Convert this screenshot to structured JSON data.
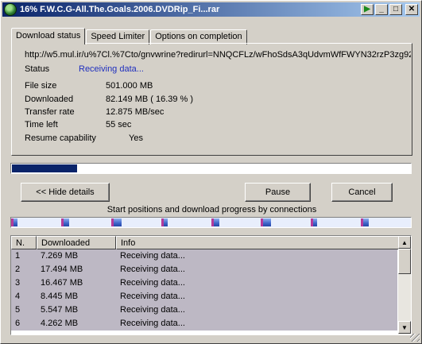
{
  "window": {
    "title": "16% F.W.C.G-All.The.Goals.2006.DVDRip_Fi...rar"
  },
  "tabs": [
    "Download status",
    "Speed Limiter",
    "Options on completion"
  ],
  "details": {
    "url": "http://w5.mul.ir/u%7Cl.%7Cto/gnvwrine?redirurl=NNQCFLz/wFhoSdsA3qUdvmWfFWYN32rzP3zg92",
    "status_label": "Status",
    "status_value": "Receiving data...",
    "file_size_label": "File size",
    "file_size_value": "501.000  MB",
    "downloaded_label": "Downloaded",
    "downloaded_value": "82.149  MB  ( 16.39 % )",
    "transfer_label": "Transfer rate",
    "transfer_value": "12.875  MB/sec",
    "time_left_label": "Time left",
    "time_left_value": "55 sec",
    "resume_label": "Resume capability",
    "resume_value": "Yes"
  },
  "progress": {
    "fraction": 0.1639
  },
  "buttons": {
    "hide_details": "<< Hide details",
    "pause": "Pause",
    "cancel": "Cancel"
  },
  "connections": {
    "caption": "Start positions and download progress by connections",
    "count": 8
  },
  "table": {
    "headers": [
      "N.",
      "Downloaded",
      "Info"
    ],
    "rows": [
      [
        "1",
        "7.269  MB",
        "Receiving data..."
      ],
      [
        "2",
        "17.494  MB",
        "Receiving data..."
      ],
      [
        "3",
        "16.467  MB",
        "Receiving data..."
      ],
      [
        "4",
        "8.445  MB",
        "Receiving data..."
      ],
      [
        "5",
        "5.547  MB",
        "Receiving data..."
      ],
      [
        "6",
        "4.262  MB",
        "Receiving data..."
      ]
    ]
  },
  "colors": {
    "title_bar": "#0a246a",
    "progress_fill": "#0a246a",
    "status_text": "#1f2fbe",
    "row_bg": "#bdb8c4"
  }
}
